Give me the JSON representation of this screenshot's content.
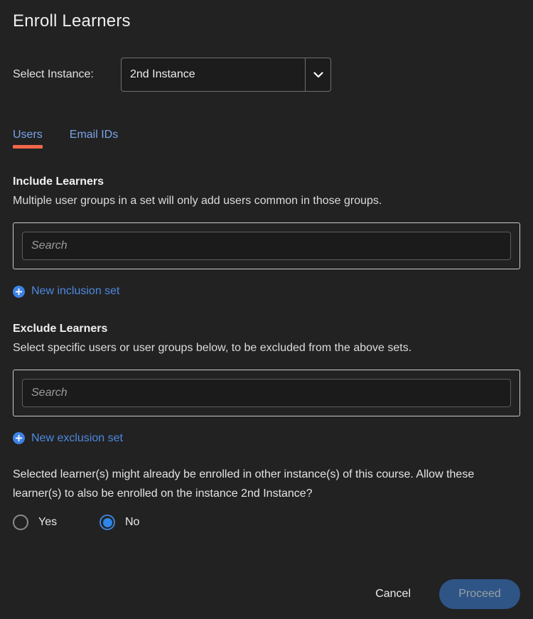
{
  "dialog": {
    "title": "Enroll Learners"
  },
  "instance": {
    "label": "Select Instance:",
    "selected": "2nd Instance",
    "chevron_icon": "chevron-down-icon"
  },
  "tabs": [
    {
      "label": "Users",
      "active": true
    },
    {
      "label": "Email IDs",
      "active": false
    }
  ],
  "include": {
    "title": "Include Learners",
    "description": "Multiple user groups in a set will only add users common in those groups.",
    "search_placeholder": "Search",
    "search_value": "",
    "add_link": "New inclusion set",
    "add_icon": "plus-circle-icon"
  },
  "exclude": {
    "title": "Exclude Learners",
    "description": "Select specific users or user groups below, to be excluded from the above sets.",
    "search_placeholder": "Search",
    "search_value": "",
    "add_link": "New exclusion set",
    "add_icon": "plus-circle-icon"
  },
  "notice": {
    "text": "Selected learner(s) might already be enrolled in other instance(s) of this course. Allow these learner(s) to also be enrolled on the instance 2nd Instance?",
    "options": [
      {
        "label": "Yes",
        "selected": false
      },
      {
        "label": "No",
        "selected": true
      }
    ]
  },
  "footer": {
    "cancel_label": "Cancel",
    "proceed_label": "Proceed",
    "proceed_disabled": true
  },
  "colors": {
    "background": "#222222",
    "tab_text": "#7aa3e8",
    "tab_underline": "#f2674a",
    "link_blue": "#4d88e0",
    "radio_blue": "#2e86e8",
    "proceed_bg": "#2e5585",
    "proceed_text": "#9aa0a6"
  }
}
